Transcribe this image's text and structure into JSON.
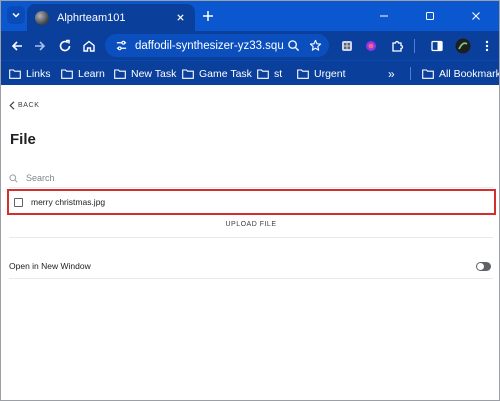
{
  "browser": {
    "tab_title": "Alphrteam101",
    "url": "daffodil-synthesizer-yz33.squ...",
    "bookmarks": [
      {
        "label": "Links"
      },
      {
        "label": "Learn"
      },
      {
        "label": "New Task"
      },
      {
        "label": "Game Task"
      },
      {
        "label": "st"
      },
      {
        "label": "Urgent"
      }
    ],
    "more_bookmarks": "»",
    "all_bookmarks": "All Bookmarks",
    "accent_color": "#0b57d0"
  },
  "page": {
    "back_label": "BACK",
    "title": "File",
    "search": {
      "placeholder": "Search",
      "value": ""
    },
    "files": [
      {
        "name": "merry christmas.jpg",
        "checked": false
      }
    ],
    "upload_label": "UPLOAD FILE",
    "open_in_new_window_label": "Open in New Window",
    "open_in_new_window_on": false,
    "highlight_color": "#d32f2f"
  }
}
